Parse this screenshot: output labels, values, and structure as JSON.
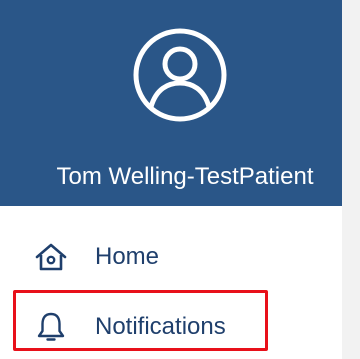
{
  "drawer": {
    "user_name": "Tom Welling-TestPatient",
    "avatar_icon": "user-circle-icon",
    "header_color": "#2a5688",
    "items": [
      {
        "label": "Home",
        "icon": "home-icon"
      },
      {
        "label": "Notifications",
        "icon": "bell-icon",
        "highlighted": true
      }
    ],
    "highlight_color": "#e8101a"
  }
}
